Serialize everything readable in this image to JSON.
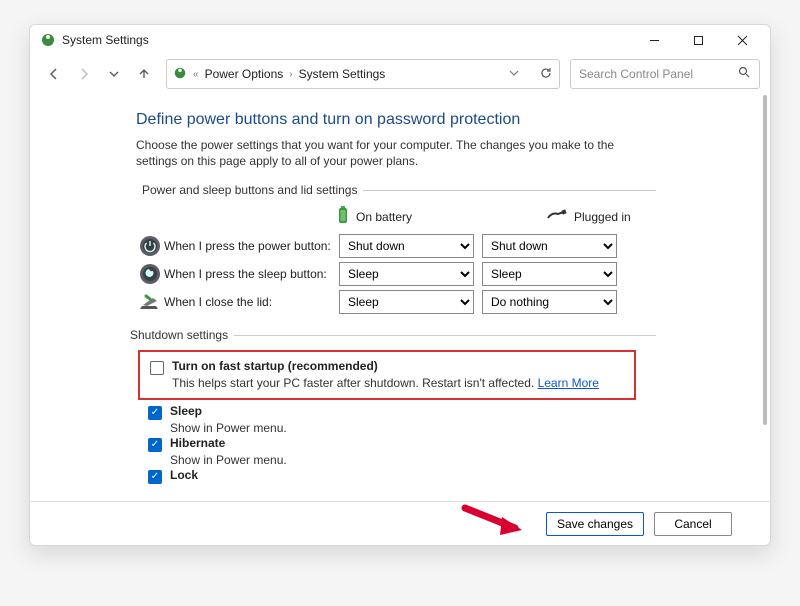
{
  "window": {
    "title": "System Settings"
  },
  "breadcrumb": {
    "part1": "Power Options",
    "part2": "System Settings"
  },
  "search": {
    "placeholder": "Search Control Panel"
  },
  "heading": "Define power buttons and turn on password protection",
  "subtext": "Choose the power settings that you want for your computer. The changes you make to the settings on this page apply to all of your power plans.",
  "section1_label": "Power and sleep buttons and lid settings",
  "columns": {
    "battery": "On battery",
    "plugged": "Plugged in"
  },
  "rows": {
    "power": {
      "label": "When I press the power button:",
      "battery_value": "Shut down",
      "plugged_value": "Shut down"
    },
    "sleep": {
      "label": "When I press the sleep button:",
      "battery_value": "Sleep",
      "plugged_value": "Sleep"
    },
    "lid": {
      "label": "When I close the lid:",
      "battery_value": "Sleep",
      "plugged_value": "Do nothing"
    }
  },
  "shutdown_label": "Shutdown settings",
  "fast_startup": {
    "title": "Turn on fast startup (recommended)",
    "desc": "This helps start your PC faster after shutdown. Restart isn't affected. ",
    "link": "Learn More"
  },
  "opts": {
    "sleep": {
      "title": "Sleep",
      "desc": "Show in Power menu."
    },
    "hibernate": {
      "title": "Hibernate",
      "desc": "Show in Power menu."
    },
    "lock": {
      "title": "Lock"
    }
  },
  "footer": {
    "save": "Save changes",
    "cancel": "Cancel"
  }
}
